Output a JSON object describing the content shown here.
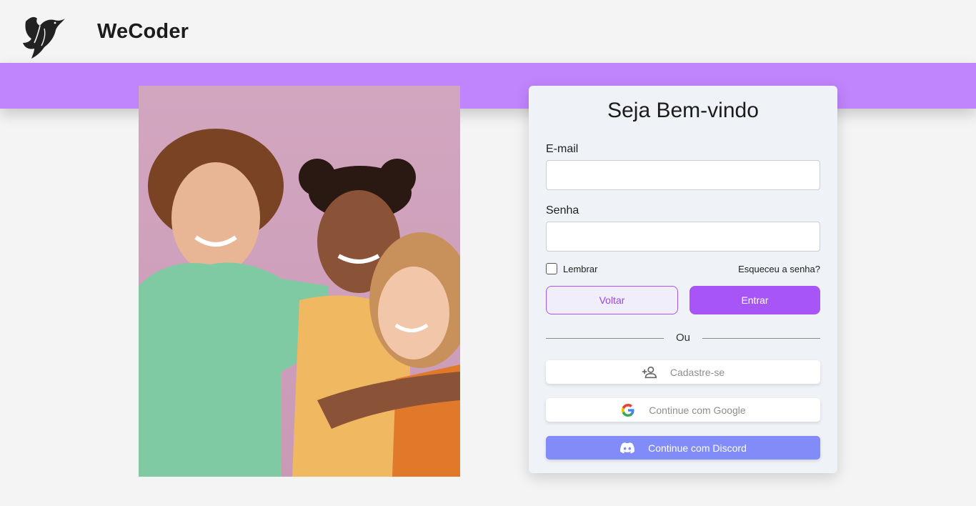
{
  "header": {
    "brand": "WeCoder",
    "logo_icon": "hummingbird-icon"
  },
  "colors": {
    "band": "#c084fc",
    "primary": "#a855f7",
    "discord": "#818cf8"
  },
  "login": {
    "title": "Seja Bem-vindo",
    "email_label": "E-mail",
    "email_value": "",
    "password_label": "Senha",
    "password_value": "",
    "remember_label": "Lembrar",
    "remember_checked": false,
    "forgot_label": "Esqueceu a senha?",
    "back_label": "Voltar",
    "enter_label": "Entrar",
    "divider_label": "Ou",
    "register_label": "Cadastre-se",
    "register_icon": "person-add-icon",
    "google_label": "Continue com Google",
    "google_icon": "google-icon",
    "discord_label": "Continue com Discord",
    "discord_icon": "discord-icon"
  },
  "photo": {
    "icon": "children-photo"
  }
}
